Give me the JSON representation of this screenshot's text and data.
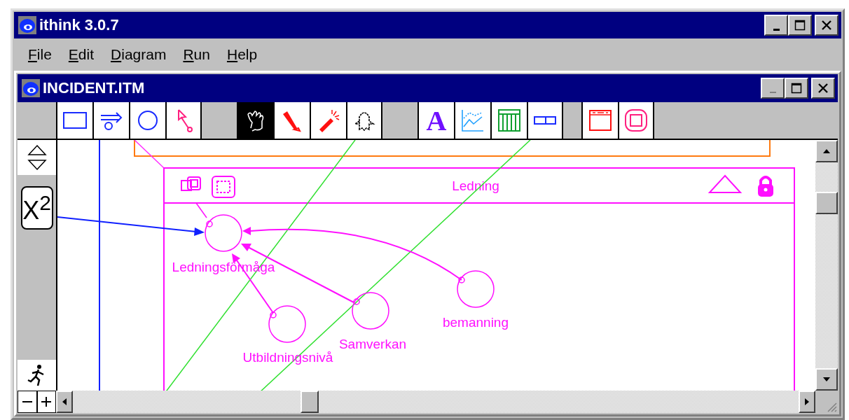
{
  "window": {
    "title": "ithink 3.0.7"
  },
  "menu": [
    "File",
    "Edit",
    "Diagram",
    "Run",
    "Help"
  ],
  "document": {
    "title": "INCIDENT.ITM"
  },
  "toolbar": [
    [
      {
        "kind": "stock",
        "selected": false
      },
      {
        "kind": "flow",
        "selected": false
      },
      {
        "kind": "converter",
        "selected": false
      },
      {
        "kind": "connector",
        "selected": false
      }
    ],
    [
      {
        "kind": "hand",
        "selected": true
      },
      {
        "kind": "brush",
        "selected": false
      },
      {
        "kind": "dynamite",
        "selected": false
      },
      {
        "kind": "ghost",
        "selected": false
      }
    ],
    [
      {
        "kind": "text",
        "label": "A",
        "selected": false
      },
      {
        "kind": "graph",
        "selected": false
      },
      {
        "kind": "table",
        "selected": false
      },
      {
        "kind": "numeric",
        "selected": false
      }
    ],
    [
      {
        "kind": "button",
        "selected": false
      },
      {
        "kind": "sector",
        "selected": false
      }
    ]
  ],
  "palette": {
    "function_button": "X$^{2}$"
  },
  "diagram": {
    "module": {
      "title": "Ledning"
    },
    "nodes": [
      {
        "label": "Ledningsförmåga"
      },
      {
        "label": "Utbildningsnivå"
      },
      {
        "label": "Samverkan"
      },
      {
        "label": "bemanning"
      }
    ]
  }
}
